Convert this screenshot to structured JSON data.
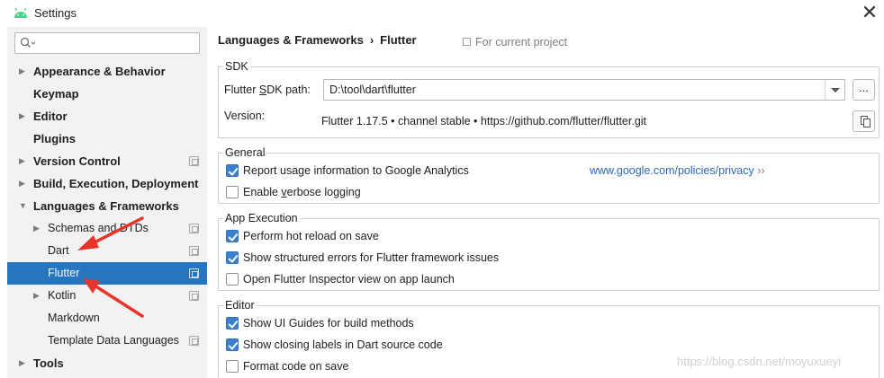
{
  "window": {
    "title": "Settings",
    "close_glyph": "✕"
  },
  "search": {
    "placeholder": "",
    "value": ""
  },
  "tree": [
    {
      "label": "Appearance & Behavior",
      "level": 0,
      "arrow": "▶",
      "project": false,
      "selected": false
    },
    {
      "label": "Keymap",
      "level": 0,
      "arrow": "",
      "project": false,
      "selected": false
    },
    {
      "label": "Editor",
      "level": 0,
      "arrow": "▶",
      "project": false,
      "selected": false
    },
    {
      "label": "Plugins",
      "level": 0,
      "arrow": "",
      "project": false,
      "selected": false
    },
    {
      "label": "Version Control",
      "level": 0,
      "arrow": "▶",
      "project": true,
      "selected": false
    },
    {
      "label": "Build, Execution, Deployment",
      "level": 0,
      "arrow": "▶",
      "project": false,
      "selected": false
    },
    {
      "label": "Languages & Frameworks",
      "level": 0,
      "arrow": "▼",
      "project": false,
      "selected": false
    },
    {
      "label": "Schemas and DTDs",
      "level": 1,
      "arrow": "▶",
      "project": true,
      "selected": false
    },
    {
      "label": "Dart",
      "level": 1,
      "arrow": "",
      "project": true,
      "selected": false
    },
    {
      "label": "Flutter",
      "level": 1,
      "arrow": "",
      "project": true,
      "selected": true
    },
    {
      "label": "Kotlin",
      "level": 1,
      "arrow": "▶",
      "project": true,
      "selected": false
    },
    {
      "label": "Markdown",
      "level": 1,
      "arrow": "",
      "project": false,
      "selected": false
    },
    {
      "label": "Template Data Languages",
      "level": 1,
      "arrow": "",
      "project": true,
      "selected": false
    },
    {
      "label": "Tools",
      "level": 0,
      "arrow": "▶",
      "project": false,
      "selected": false
    }
  ],
  "header": {
    "breadcrumb_parent": "Languages & Frameworks",
    "breadcrumb_sep": "›",
    "breadcrumb_current": "Flutter",
    "scope_note": "For current project"
  },
  "sdk": {
    "legend": "SDK",
    "path_label_pre": "Flutter ",
    "path_label_mn": "S",
    "path_label_post": "DK path:",
    "path_value": "D:\\tool\\dart\\flutter",
    "browse_label": "...",
    "version_label": "Version:",
    "version_value": "Flutter 1.17.5 • channel stable • https://github.com/flutter/flutter.git"
  },
  "general": {
    "legend": "General",
    "analytics_label": "Report usage information to Google Analytics",
    "analytics_checked": true,
    "privacy_link": "www.google.com/policies/privacy",
    "privacy_arrow": "››",
    "verbose_pre": "Enable ",
    "verbose_mn": "v",
    "verbose_post": "erbose logging",
    "verbose_checked": false
  },
  "app_execution": {
    "legend": "App Execution",
    "hot_reload_label": "Perform hot reload on save",
    "hot_reload_checked": true,
    "structured_errors_label": "Show structured errors for Flutter framework issues",
    "structured_errors_checked": true,
    "inspector_label": "Open Flutter Inspector view on app launch",
    "inspector_checked": false
  },
  "editor": {
    "legend": "Editor",
    "ui_guides_label": "Show UI Guides for build methods",
    "ui_guides_checked": true,
    "closing_labels_label": "Show closing labels in Dart source code",
    "closing_labels_checked": true,
    "format_label": "Format code on save",
    "format_checked": false
  },
  "watermark": "https://blog.csdn.net/moyuxueyi",
  "colors": {
    "selection": "#2675bf",
    "link": "#2e66b8",
    "annotation_arrow": "#e8352b",
    "android_green": "#3ddc84"
  }
}
